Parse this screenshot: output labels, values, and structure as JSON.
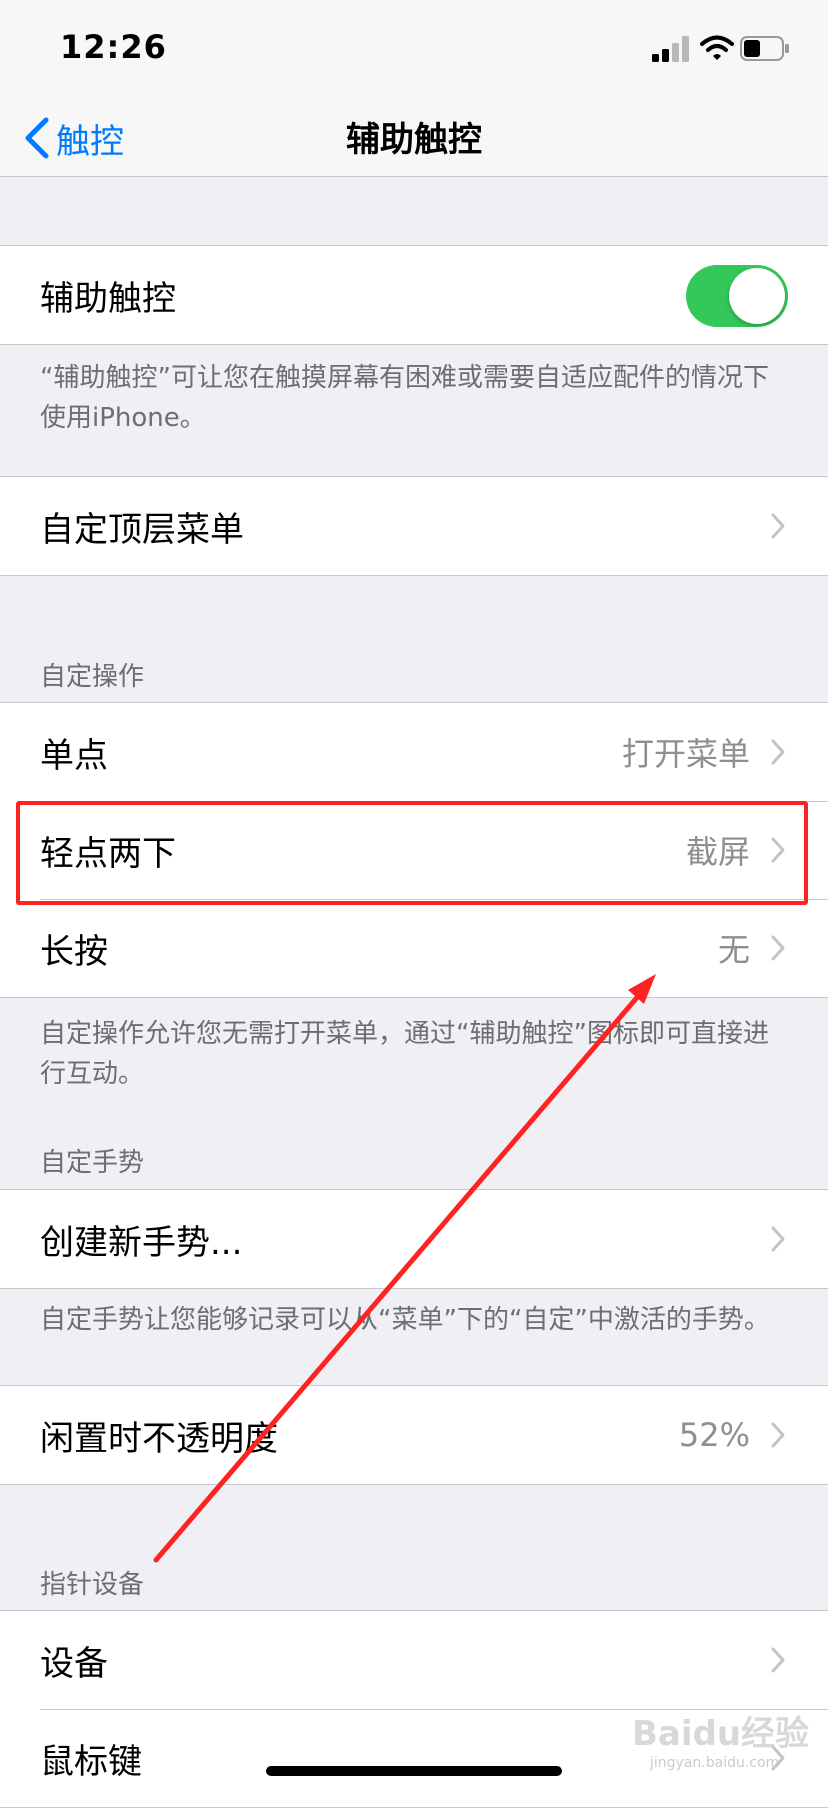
{
  "status_bar": {
    "time": "12:26"
  },
  "nav": {
    "back_label": "触控",
    "title": "辅助触控"
  },
  "assistive_touch": {
    "label": "辅助触控",
    "enabled": true,
    "footer": "“辅助触控”可让您在触摸屏幕有困难或需要自适应配件的情况下使用iPhone。"
  },
  "top_menu": {
    "label": "自定顶层菜单"
  },
  "custom_actions": {
    "header": "自定操作",
    "items": [
      {
        "label": "单点",
        "value": "打开菜单"
      },
      {
        "label": "轻点两下",
        "value": "截屏"
      },
      {
        "label": "长按",
        "value": "无"
      }
    ],
    "footer": "自定操作允许您无需打开菜单，通过“辅助触控”图标即可直接进行互动。"
  },
  "custom_gestures": {
    "header": "自定手势",
    "create_label": "创建新手势...",
    "footer": "自定手势让您能够记录可以从“菜单”下的“自定”中激活的手势。"
  },
  "idle_opacity": {
    "label": "闲置时不透明度",
    "value": "52%"
  },
  "pointer_devices": {
    "header": "指针设备",
    "items": [
      {
        "label": "设备"
      },
      {
        "label": "鼠标键"
      }
    ]
  },
  "watermark": {
    "brand": "Baidu经验",
    "url": "jingyan.baidu.com"
  },
  "colors": {
    "accent": "#007aff",
    "toggle_on": "#34c759",
    "annotation": "#ff2222"
  }
}
